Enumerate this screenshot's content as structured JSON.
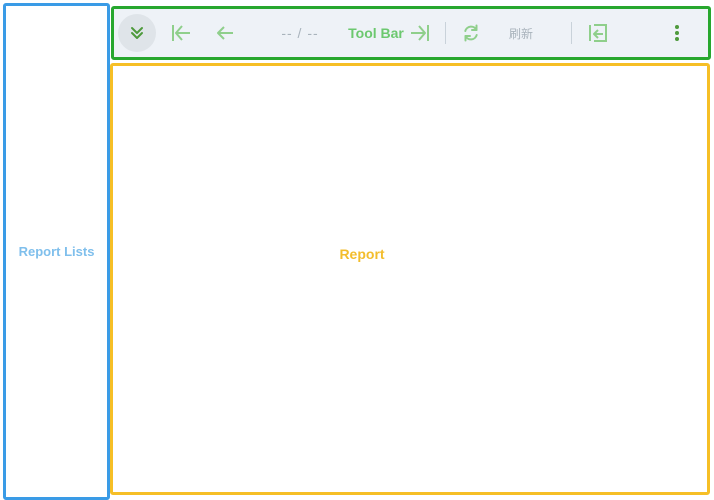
{
  "sidebar": {
    "label": "Report Lists",
    "border_color": "#3a9be6",
    "text_color": "#7fbfec"
  },
  "toolbar": {
    "title": "Tool Bar",
    "page_indicator": "-- / --",
    "refresh_label": "刷新",
    "border_color": "#27a72e",
    "background": "#eef2f7",
    "icon_color": "#8fcf8b",
    "icons": [
      "chevrons-down-icon",
      "first-page-icon",
      "previous-page-icon",
      "last-page-icon",
      "refresh-icon",
      "export-icon",
      "more-vertical-icon"
    ]
  },
  "report": {
    "label": "Report",
    "border_color": "#f6bf26",
    "text_color": "#f3bd2c"
  }
}
